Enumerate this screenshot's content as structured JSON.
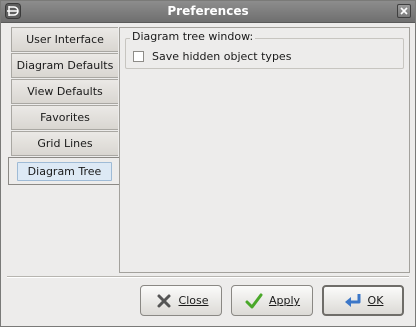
{
  "window": {
    "title": "Preferences"
  },
  "tabs": [
    {
      "label": "User Interface"
    },
    {
      "label": "Diagram Defaults"
    },
    {
      "label": "View Defaults"
    },
    {
      "label": "Favorites"
    },
    {
      "label": "Grid Lines"
    },
    {
      "label": "Diagram Tree"
    }
  ],
  "panel": {
    "group_title": "Diagram tree window:",
    "checkbox_label": "Save hidden object types",
    "checkbox_checked": false
  },
  "buttons": {
    "close": "Close",
    "apply": "Apply",
    "ok": "OK"
  },
  "colors": {
    "titlebar": "#7f7f7f",
    "active_tab_highlight": "#dde9f5",
    "apply_check": "#4aa82a",
    "ok_arrow": "#3c77c8",
    "close_x": "#555555"
  }
}
